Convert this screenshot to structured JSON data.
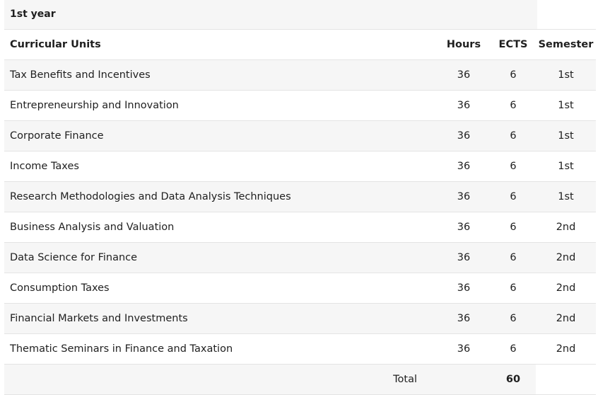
{
  "year_heading": "1st year",
  "headers": {
    "name": "Curricular Units",
    "hours": "Hours",
    "ects": "ECTS",
    "semester": "Semester"
  },
  "rows": [
    {
      "name": "Tax Benefits and Incentives",
      "hours": "36",
      "ects": "6",
      "semester": "1st"
    },
    {
      "name": "Entrepreneurship and Innovation",
      "hours": "36",
      "ects": "6",
      "semester": "1st"
    },
    {
      "name": "Corporate Finance",
      "hours": "36",
      "ects": "6",
      "semester": "1st"
    },
    {
      "name": "Income Taxes",
      "hours": "36",
      "ects": "6",
      "semester": "1st"
    },
    {
      "name": "Research Methodologies and Data Analysis Techniques",
      "hours": "36",
      "ects": "6",
      "semester": "1st"
    },
    {
      "name": "Business Analysis and Valuation",
      "hours": "36",
      "ects": "6",
      "semester": "2nd"
    },
    {
      "name": "Data Science for Finance",
      "hours": "36",
      "ects": "6",
      "semester": "2nd"
    },
    {
      "name": "Consumption Taxes",
      "hours": "36",
      "ects": "6",
      "semester": "2nd"
    },
    {
      "name": "Financial Markets and Investments",
      "hours": "36",
      "ects": "6",
      "semester": "2nd"
    },
    {
      "name": "Thematic Seminars in Finance and Taxation",
      "hours": "36",
      "ects": "6",
      "semester": "2nd"
    }
  ],
  "total": {
    "label": "Total",
    "ects": "60"
  }
}
